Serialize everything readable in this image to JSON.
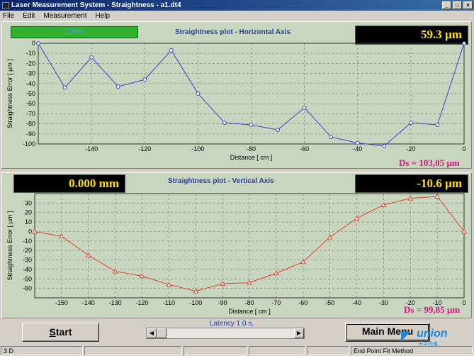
{
  "window": {
    "title": "Laser Measurement System - Straightness - a1.dt4"
  },
  "menu": [
    "File",
    "Edit",
    "Measurement",
    "Help"
  ],
  "progress": {
    "label": "100%",
    "percent": 100
  },
  "horizontal": {
    "readout": "59.3  µm",
    "ds": "Ds = 103,05 µm"
  },
  "vertical": {
    "left_readout": "0.000  mm",
    "right_readout": "-10.6  µm",
    "ds": "Ds = 99,85 µm"
  },
  "controls": {
    "start_label": "Start",
    "start_shortcut": "S",
    "start_rest": "tart",
    "latency_label": "Latency 1.0 s.",
    "main_menu_label": "Main Menu"
  },
  "status": {
    "left": "3 D",
    "right": "End Point Fit Method"
  },
  "watermark": {
    "text": "union",
    "sub": "天华光电"
  },
  "colors": {
    "plot_bg": "#c8d6c0",
    "horizontal_line": "#3b43c8",
    "vertical_line": "#e0402a",
    "readout_text": "#ffe000",
    "ds_text": "#d01880",
    "title_text": "#2a3ea8"
  },
  "chart_data": [
    {
      "type": "line",
      "title": "Straightness plot - Horizontal Axis",
      "xlabel": "Distance [ cm ]",
      "ylabel": "Straightness Error [ µm ]",
      "xlim": [
        -160,
        0
      ],
      "ylim": [
        -100,
        0
      ],
      "xticks": [
        -140,
        -120,
        -100,
        -80,
        -60,
        -40,
        -20,
        0
      ],
      "yticks": [
        0,
        -10,
        -20,
        -30,
        -40,
        -50,
        -60,
        -70,
        -80,
        -90,
        -100
      ],
      "grid": true,
      "series": [
        {
          "x": [
            -160,
            -150,
            -140,
            -130,
            -120,
            -110,
            -100,
            -90,
            -80,
            -70,
            -60,
            -50,
            -40,
            -30,
            -20,
            -10,
            0
          ],
          "y": [
            0,
            -44,
            -14,
            -43,
            -36,
            -7,
            -50,
            -79,
            -81,
            -86,
            -64,
            -93,
            -99,
            -102,
            -79,
            -81,
            0
          ]
        }
      ]
    },
    {
      "type": "line",
      "title": "Straightness plot - Vertical Axis",
      "xlabel": "Distance [ cm ]",
      "ylabel": "Straightness Error [ µm ]",
      "xlim": [
        -160,
        0
      ],
      "ylim": [
        -70,
        40
      ],
      "xticks": [
        -150,
        -140,
        -130,
        -120,
        -110,
        -100,
        -90,
        -80,
        -70,
        -60,
        -50,
        -40,
        -30,
        -20,
        -10,
        0
      ],
      "yticks": [
        30,
        20,
        10,
        0,
        -10,
        -20,
        -30,
        -40,
        -50,
        -60
      ],
      "grid": true,
      "series": [
        {
          "x": [
            -160,
            -150,
            -140,
            -130,
            -120,
            -110,
            -100,
            -90,
            -80,
            -70,
            -60,
            -50,
            -40,
            -30,
            -20,
            -10,
            0
          ],
          "y": [
            0,
            -5,
            -25,
            -42,
            -47,
            -56,
            -63,
            -55,
            -54,
            -44,
            -32,
            -6,
            14,
            28,
            35,
            37,
            0
          ]
        }
      ]
    }
  ]
}
